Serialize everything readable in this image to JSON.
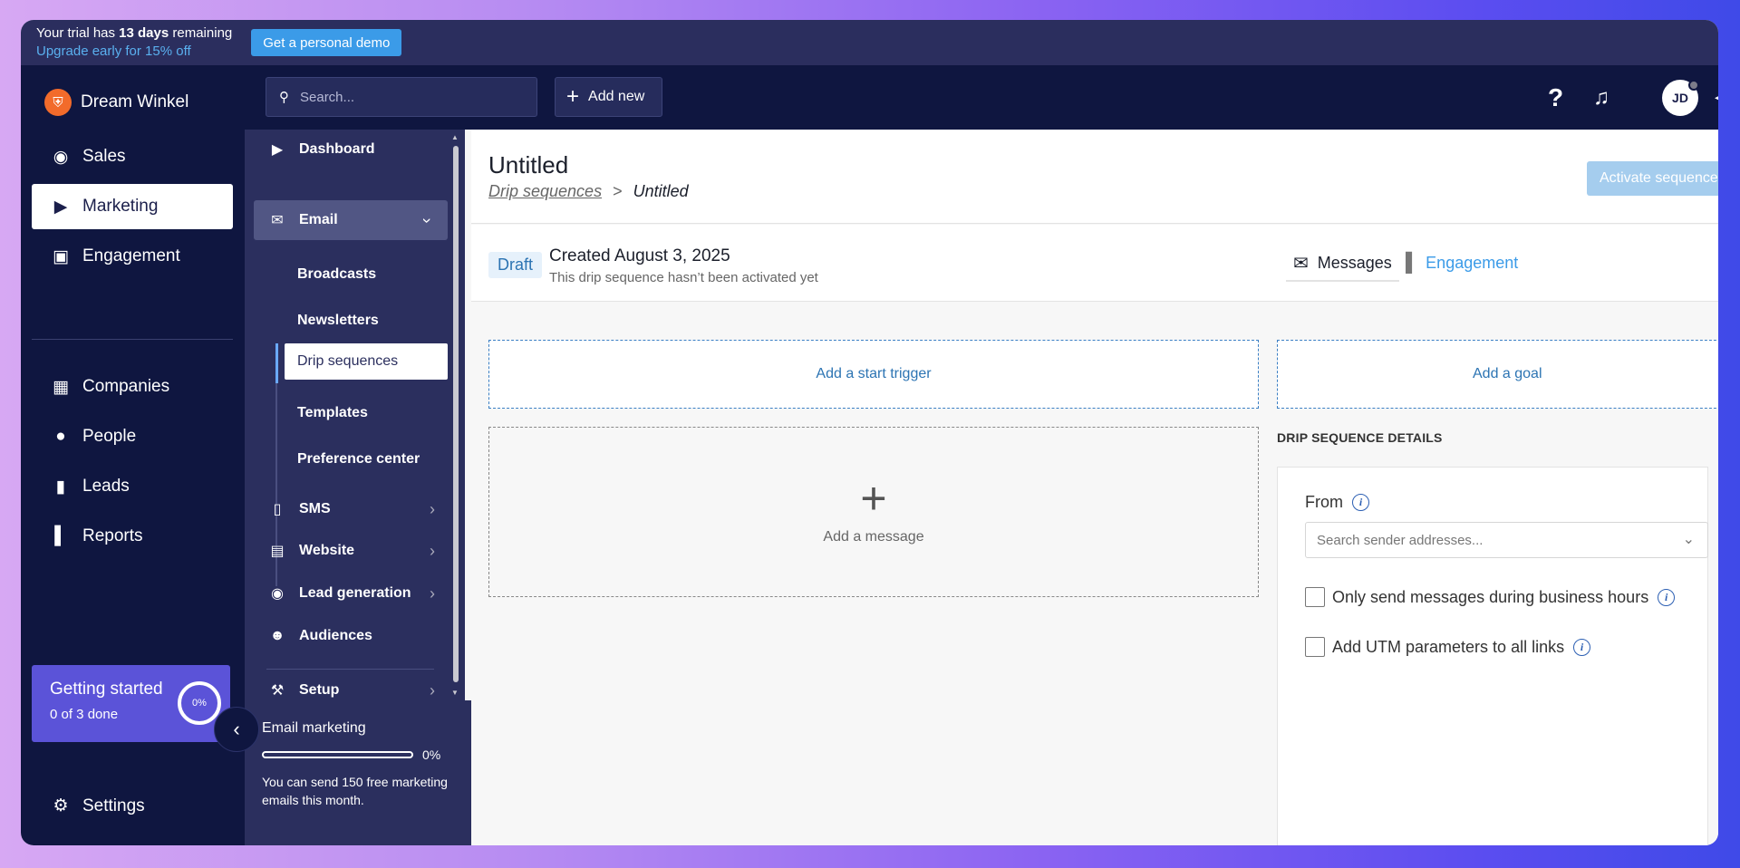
{
  "trial": {
    "line1_pre": "Your trial has ",
    "line1_bold": "13 days",
    "line1_post": " remaining",
    "line2": "Upgrade early for 15% off",
    "demo_button": "Get a personal demo"
  },
  "brand": {
    "name": "Dream Winkel",
    "logo_icon": "shield-icon"
  },
  "nav": {
    "items": [
      {
        "label": "Sales",
        "icon": "dollar-icon"
      },
      {
        "label": "Marketing",
        "icon": "megaphone-icon"
      },
      {
        "label": "Engagement",
        "icon": "chat-icon"
      },
      {
        "label": "Companies",
        "icon": "building-icon"
      },
      {
        "label": "People",
        "icon": "person-icon"
      },
      {
        "label": "Leads",
        "icon": "ticket-icon"
      },
      {
        "label": "Reports",
        "icon": "bar-chart-icon"
      }
    ],
    "settings": "Settings"
  },
  "getting_started": {
    "title": "Getting started",
    "progress": "0 of 3 done",
    "percent": "0%"
  },
  "topbar": {
    "search_placeholder": "Search...",
    "add_new": "Add new",
    "avatar_initials": "JD"
  },
  "subnav": {
    "dashboard": "Dashboard",
    "email": "Email",
    "email_children": [
      "Broadcasts",
      "Newsletters",
      "Drip sequences",
      "Templates",
      "Preference center"
    ],
    "sms": "SMS",
    "website": "Website",
    "lead_generation": "Lead generation",
    "audiences": "Audiences",
    "setup": "Setup"
  },
  "quota": {
    "title": "Email marketing",
    "percent": "0%",
    "percent_value": 0,
    "note": "You can send 150 free marketing emails this month."
  },
  "main": {
    "title": "Untitled",
    "breadcrumb_link": "Drip sequences",
    "breadcrumb_sep": ">",
    "breadcrumb_current": "Untitled",
    "activate_button": "Activate sequence",
    "status_badge": "Draft",
    "created": "Created August 3, 2025",
    "not_activated": "This drip sequence hasn’t been activated yet",
    "tab_messages": "Messages",
    "tab_engagement": "Engagement",
    "add_trigger": "Add a start trigger",
    "add_goal": "Add a goal",
    "add_message": "Add a message",
    "details_title": "DRIP SEQUENCE DETAILS",
    "from_label": "From",
    "sender_placeholder": "Search sender addresses...",
    "business_hours": "Only send messages during business hours",
    "utm": "Add UTM parameters to all links"
  },
  "colors": {
    "nav_bg": "#0f1640",
    "subnav_bg": "#2b2f5e",
    "accent": "#3b9be8",
    "getting_started_bg": "#5b53d8",
    "brand_orange": "#f26b2b"
  }
}
